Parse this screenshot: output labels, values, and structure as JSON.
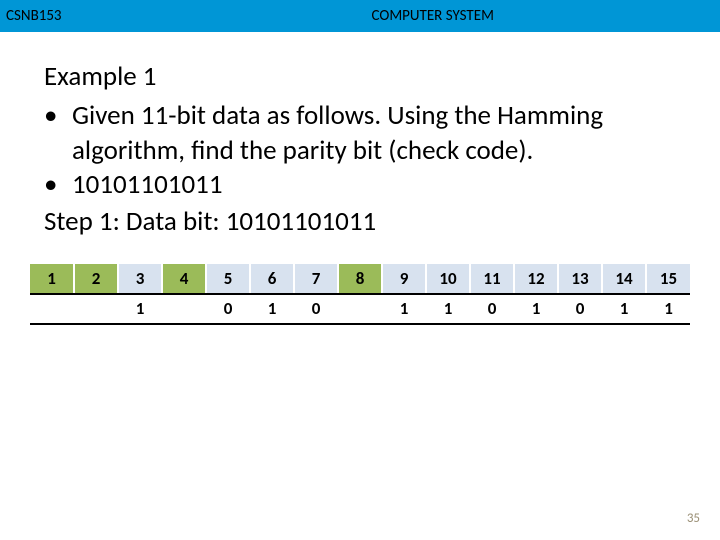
{
  "header": {
    "course_code": "CSNB153",
    "course_title": "COMPUTER SYSTEM"
  },
  "body": {
    "example_title": "Example 1",
    "bullet1": "Given 11-bit data as follows. Using the Hamming algorithm, find the parity bit (check code).",
    "bullet2": "10101101011",
    "step_line": "Step 1: Data bit: 10101101011"
  },
  "table": {
    "positions": [
      {
        "n": "1",
        "parity": true,
        "val": ""
      },
      {
        "n": "2",
        "parity": true,
        "val": ""
      },
      {
        "n": "3",
        "parity": false,
        "val": "1"
      },
      {
        "n": "4",
        "parity": true,
        "val": ""
      },
      {
        "n": "5",
        "parity": false,
        "val": "0"
      },
      {
        "n": "6",
        "parity": false,
        "val": "1"
      },
      {
        "n": "7",
        "parity": false,
        "val": "0"
      },
      {
        "n": "8",
        "parity": true,
        "val": ""
      },
      {
        "n": "9",
        "parity": false,
        "val": "1"
      },
      {
        "n": "10",
        "parity": false,
        "val": "1"
      },
      {
        "n": "11",
        "parity": false,
        "val": "0"
      },
      {
        "n": "12",
        "parity": false,
        "val": "1"
      },
      {
        "n": "13",
        "parity": false,
        "val": "0"
      },
      {
        "n": "14",
        "parity": false,
        "val": "1"
      },
      {
        "n": "15",
        "parity": false,
        "val": "1"
      }
    ]
  },
  "footer": {
    "page_number": "35"
  }
}
